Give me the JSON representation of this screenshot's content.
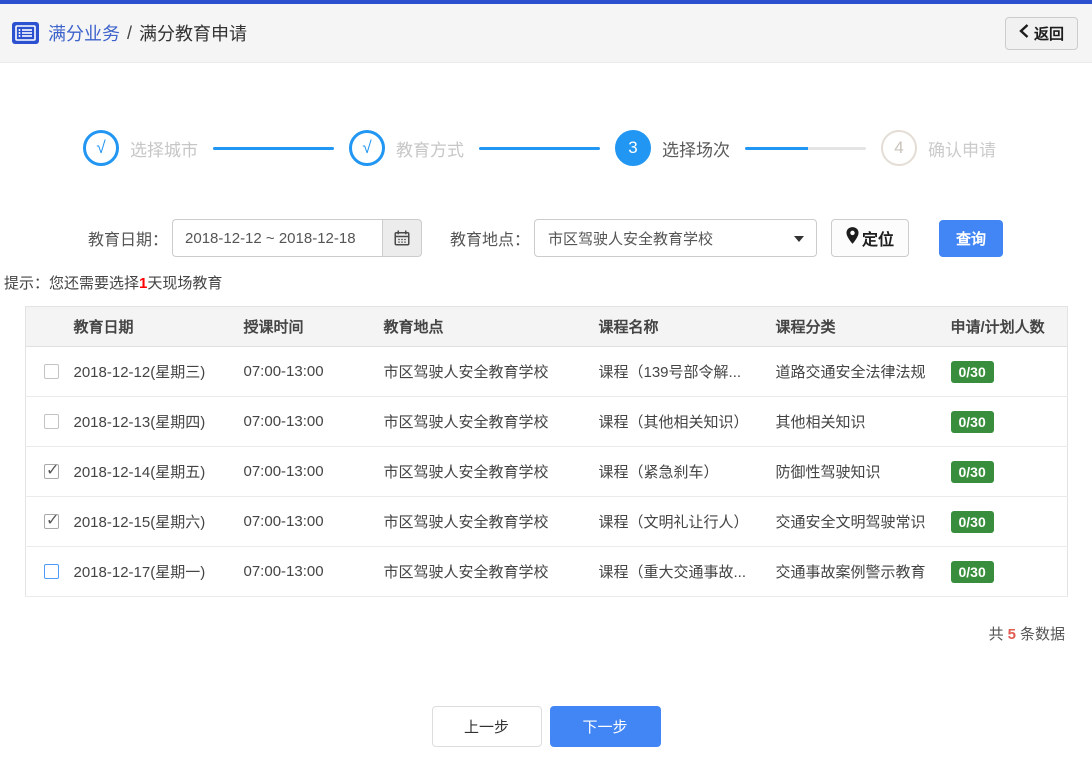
{
  "header": {
    "breadcrumb_root": "满分业务",
    "breadcrumb_sep": "/",
    "breadcrumb_current": "满分教育申请",
    "back_label": "返回"
  },
  "steps": {
    "items": [
      {
        "symbol": "√",
        "label": "选择城市",
        "state": "done"
      },
      {
        "symbol": "√",
        "label": "教育方式",
        "state": "done"
      },
      {
        "symbol": "3",
        "label": "选择场次",
        "state": "active"
      },
      {
        "symbol": "4",
        "label": "确认申请",
        "state": "pending"
      }
    ]
  },
  "filters": {
    "date_label": "教育日期：",
    "date_value": "2018-12-12 ~ 2018-12-18",
    "location_label": "教育地点：",
    "location_value": "市区驾驶人安全教育学校",
    "locate_label": "定位",
    "search_label": "查询"
  },
  "tip": {
    "prefix": "提示：您还需要选择",
    "highlight": "1",
    "suffix": "天现场教育"
  },
  "table": {
    "columns": [
      "教育日期",
      "授课时间",
      "教育地点",
      "课程名称",
      "课程分类",
      "申请/计划人数"
    ],
    "rows": [
      {
        "checkbox": "unchecked",
        "date": "2018-12-12(星期三)",
        "time": "07:00-13:00",
        "location": "市区驾驶人安全教育学校",
        "course": "课程（139号部令解...",
        "category": "道路交通安全法律法规",
        "count": "0/30"
      },
      {
        "checkbox": "unchecked",
        "date": "2018-12-13(星期四)",
        "time": "07:00-13:00",
        "location": "市区驾驶人安全教育学校",
        "course": "课程（其他相关知识）",
        "category": "其他相关知识",
        "count": "0/30"
      },
      {
        "checkbox": "checked",
        "date": "2018-12-14(星期五)",
        "time": "07:00-13:00",
        "location": "市区驾驶人安全教育学校",
        "course": "课程（紧急刹车）",
        "category": "防御性驾驶知识",
        "count": "0/30"
      },
      {
        "checkbox": "checked",
        "date": "2018-12-15(星期六)",
        "time": "07:00-13:00",
        "location": "市区驾驶人安全教育学校",
        "course": "课程（文明礼让行人）",
        "category": "交通安全文明驾驶常识",
        "count": "0/30"
      },
      {
        "checkbox": "unchecked-active",
        "date": "2018-12-17(星期一)",
        "time": "07:00-13:00",
        "location": "市区驾驶人安全教育学校",
        "course": "课程（重大交通事故...",
        "category": "交通事故案例警示教育",
        "count": "0/30"
      }
    ]
  },
  "summary": {
    "prefix": "共",
    "count": "5",
    "suffix": "条数据"
  },
  "footer": {
    "prev_label": "上一步",
    "next_label": "下一步"
  },
  "colors": {
    "brand_blue": "#2b50d0",
    "accent_blue": "#2196f3",
    "button_blue": "#4285f4",
    "badge_green": "#388e3c",
    "alert_red": "#ff0000",
    "count_red": "#e25b50"
  }
}
